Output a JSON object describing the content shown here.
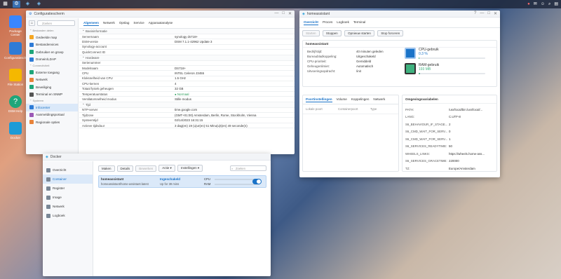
{
  "taskbar": {
    "icons": [
      "grid-icon",
      "control-panel-icon",
      "docker-icon",
      "docker-icon"
    ]
  },
  "desktop_icons": [
    {
      "label": "Package Center",
      "color": "#3a86ff"
    },
    {
      "label": "Configuratiescherm",
      "color": "#2e7bd6"
    },
    {
      "label": "File Station",
      "color": "#f5b800"
    },
    {
      "label": "DSM Help",
      "color": "#1fa67a"
    },
    {
      "label": "Docker",
      "color": "#1d9bd7"
    }
  ],
  "config_window": {
    "title": "Configuratiescherm",
    "search_placeholder": "Zoeken",
    "tabs": [
      "Algemeen",
      "Netwerk",
      "Opslag",
      "Service",
      "Apparaatanalyse"
    ],
    "sidebar": [
      {
        "type": "head",
        "label": "Bestanden delen"
      },
      {
        "type": "item",
        "label": "Gedeelde map",
        "color": "#f5a623"
      },
      {
        "type": "item",
        "label": "Bestandenvices",
        "color": "#2e7bd6"
      },
      {
        "type": "item",
        "label": "Gebruiker en groep",
        "color": "#1fa67a"
      },
      {
        "type": "item",
        "label": "Domein/LDAP",
        "color": "#2e7bd6"
      },
      {
        "type": "head",
        "label": "Connectiviteit"
      },
      {
        "type": "item",
        "label": "Externe toegang",
        "color": "#1fa67a"
      },
      {
        "type": "item",
        "label": "Netwerk",
        "color": "#e8833a"
      },
      {
        "type": "item",
        "label": "Beveiliging",
        "color": "#1fa67a"
      },
      {
        "type": "item",
        "label": "Terminal en SNMP",
        "color": "#555555"
      },
      {
        "type": "head",
        "label": "Systeem"
      },
      {
        "type": "item",
        "label": "Infocenter",
        "color": "#2e7bd6",
        "selected": true
      },
      {
        "type": "item",
        "label": "Aanmeldingsportaal",
        "color": "#9b59b6"
      },
      {
        "type": "item",
        "label": "Regionale opties",
        "color": "#e8833a"
      }
    ],
    "sections": [
      {
        "title": "Basisinformatie",
        "rows": [
          [
            "Servernaam",
            "synology ds718+"
          ],
          [
            "DSM-versie",
            "DSM 7.1.1-42962 Update 3"
          ],
          [
            "Synology-account",
            ""
          ],
          [
            "QuickConnect ID",
            ""
          ]
        ]
      },
      {
        "title": "Hardware",
        "rows": [
          [
            "Serienummer",
            ""
          ],
          [
            "Modelnaam",
            "DS718+"
          ],
          [
            "CPU",
            "INTEL Celeron J3455"
          ],
          [
            "Kloksnelheid van CPU",
            "1.5 GHz"
          ],
          [
            "CPU-kernen",
            "4"
          ],
          [
            "Totaal fysiek geheugen",
            "32 GB"
          ],
          [
            "Temperatuurstatus",
            "Normaal"
          ],
          [
            "Ventilatorsnelheid modus",
            "Stille modus"
          ]
        ]
      },
      {
        "title": "Tijd",
        "rows": [
          [
            "NTP-server",
            "time.google.com"
          ],
          [
            "Tijdzone",
            "(GMT+01:00) Amsterdam, Berlin, Rome, Stockholm, Vienna"
          ],
          [
            "Systeemtijd",
            "02/14/2023 16:31:15"
          ],
          [
            "Actieve tijdsduur",
            "3 dag(en) 19 (u)ur(en) 51 Minu(u)t(en) 49 seconde(n)"
          ]
        ]
      }
    ]
  },
  "ha_window": {
    "title": "homeassistant",
    "tabs": [
      "Overzicht",
      "Proces",
      "Logboek",
      "Terminal"
    ],
    "actions": [
      "Starten",
      "Stoppen",
      "Opnieuw starten",
      "Stop forceren"
    ],
    "panel_title": "homeassistant",
    "details": [
      [
        "Bedrijfstijd:",
        "40 minuten geleden"
      ],
      [
        "Bureaubladkoppeling:",
        "Uitgeschakeld"
      ],
      [
        "CPU-prioriteit:",
        "Gemiddeld"
      ],
      [
        "Geheugenlimiet:",
        "Automatisch"
      ],
      [
        "Uitvoeringsopdracht:",
        "/init"
      ]
    ],
    "cpu": {
      "label": "CPU-gebruik",
      "value": "0.3 %",
      "fraction": 0.003
    },
    "ram": {
      "label": "RAM-gebruik",
      "value": "193 MB",
      "fraction": 0.02
    },
    "subtabs": [
      "Poortinstellingen",
      "Volume",
      "Koppelingen",
      "Netwerk"
    ],
    "port_headers": [
      "Lokale poort",
      "Containerpoort",
      "Type"
    ],
    "env_title": "Omgevingsvariabelen",
    "env": [
      [
        "PATH:",
        "/usr/local/bin:/usr/local/..."
      ],
      [
        "LANG:",
        "C.UTF-8"
      ],
      [
        "S6_BEHAVIOUR_IF_STAGE...",
        "2"
      ],
      [
        "S6_CMD_WAIT_FOR_SERV...",
        "0"
      ],
      [
        "S6_CMD_WAIT_FOR_SERV...",
        "1"
      ],
      [
        "S6_SERVICES_READYTIME:",
        "50"
      ],
      [
        "WHEELS_LINKS:",
        "https://wheels.home-ass..."
      ],
      [
        "S6_SERVICES_GRACETIME:",
        "220000"
      ],
      [
        "TZ:",
        "Europe/Amsterdam"
      ]
    ]
  },
  "docker_window": {
    "title": "Docker",
    "sidebar": [
      "Overzicht",
      "Container",
      "Register",
      "Image",
      "Netwerk",
      "Logboek"
    ],
    "selected": "Container",
    "toolbar": [
      "Maken",
      "Details",
      "Bewerken",
      "Actie ▾",
      "Instellingen ▾"
    ],
    "search_placeholder": "Zoeken",
    "container": {
      "name": "homeassistant",
      "image": "homeassistant/home-assistant:latest",
      "status": "Ingeschakeld",
      "uptime": "Up for 39 mins",
      "cpu_label": "CPU",
      "ram_label": "RAM"
    }
  }
}
